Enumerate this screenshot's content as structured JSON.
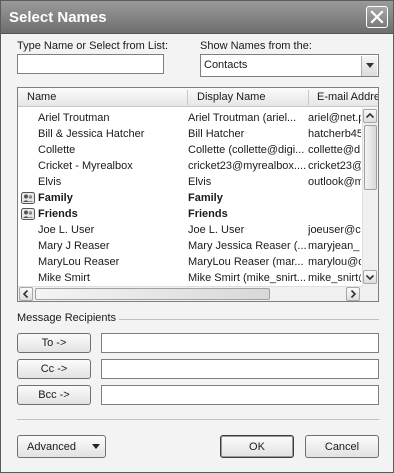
{
  "window": {
    "title": "Select Names"
  },
  "search": {
    "label": "Type Name or Select from List:",
    "value": ""
  },
  "source": {
    "label": "Show Names from the:",
    "selected": "Contacts"
  },
  "list": {
    "columns": [
      "Name",
      "Display Name",
      "E-mail Addre"
    ],
    "rows": [
      {
        "name": "Ariel Troutman",
        "display": "Ariel Troutman (ariel...",
        "email": "ariel@net.p",
        "group": false
      },
      {
        "name": "Bill & Jessica Hatcher",
        "display": "Bill Hatcher",
        "email": "hatcherb45",
        "group": false
      },
      {
        "name": "Collette",
        "display": "Collette (collette@digi...",
        "email": "collette@d",
        "group": false
      },
      {
        "name": "Cricket - Myrealbox",
        "display": "cricket23@myrealbox....",
        "email": "cricket23@",
        "group": false
      },
      {
        "name": "Elvis",
        "display": "Elvis",
        "email": "outlook@m",
        "group": false
      },
      {
        "name": "Family",
        "display": "Family",
        "email": "",
        "group": true
      },
      {
        "name": "Friends",
        "display": "Friends",
        "email": "",
        "group": true
      },
      {
        "name": "Joe L. User",
        "display": "Joe L. User",
        "email": "joeuser@c",
        "group": false
      },
      {
        "name": "Mary J Reaser",
        "display": "Mary Jessica Reaser (...",
        "email": "maryjean_",
        "group": false
      },
      {
        "name": "MaryLou Reaser",
        "display": "MaryLou Reaser (mar...",
        "email": "marylou@d",
        "group": false
      },
      {
        "name": "Mike Smirt",
        "display": "Mike Smirt (mike_snirt...",
        "email": "mike_snirt@",
        "group": false
      }
    ]
  },
  "recipients": {
    "label": "Message Recipients",
    "to": {
      "label": "To ->",
      "value": ""
    },
    "cc": {
      "label": "Cc ->",
      "value": ""
    },
    "bcc": {
      "label": "Bcc ->",
      "value": ""
    }
  },
  "footer": {
    "advanced": "Advanced",
    "ok": "OK",
    "cancel": "Cancel"
  },
  "icons": {
    "close": "close-icon",
    "dropdown": "chevron-down-icon",
    "group": "distribution-list-icon",
    "scroll_up": "arrow-up-icon",
    "scroll_down": "arrow-down-icon",
    "scroll_left": "arrow-left-icon",
    "scroll_right": "arrow-right-icon"
  },
  "colors": {
    "titlebar": "#7f7f7f",
    "dialog_bg": "#f3f3f3",
    "border": "#7f7f7f"
  }
}
